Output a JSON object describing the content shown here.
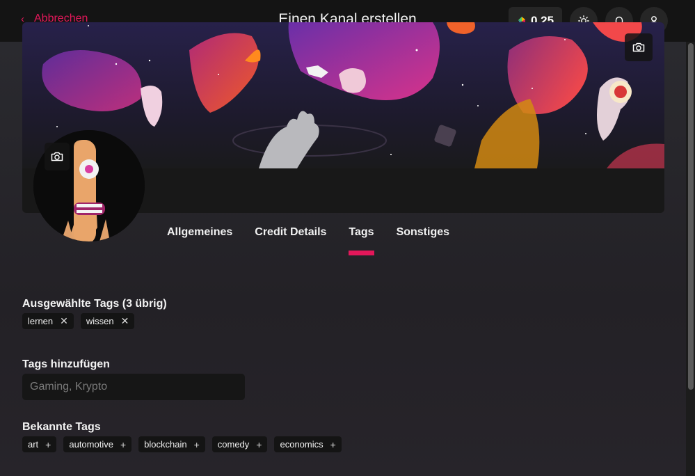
{
  "header": {
    "cancel_label": "Abbrechen",
    "title": "Einen Kanal erstellen",
    "credits": "0.25"
  },
  "tabs": [
    {
      "label": "Allgemeines",
      "active": false
    },
    {
      "label": "Credit Details",
      "active": false
    },
    {
      "label": "Tags",
      "active": true
    },
    {
      "label": "Sonstiges",
      "active": false
    }
  ],
  "selected_tags": {
    "label": "Ausgewählte Tags (3 übrig)",
    "items": [
      "lernen",
      "wissen"
    ]
  },
  "add_tags": {
    "label": "Tags hinzufügen",
    "placeholder": "Gaming, Krypto"
  },
  "known_tags": {
    "label": "Bekannte Tags",
    "items": [
      "art",
      "automotive",
      "blockchain",
      "comedy",
      "economics"
    ]
  },
  "colors": {
    "accent": "#e3175a",
    "header_bg": "#141414",
    "tag_bg": "#141414"
  },
  "icons": {
    "back": "chevron-left-icon",
    "credits": "lbc-credits-icon",
    "theme": "sun-icon",
    "notifications": "bell-icon",
    "account": "user-icon",
    "upload": "camera-icon",
    "remove": "close-icon",
    "add": "plus-icon"
  }
}
